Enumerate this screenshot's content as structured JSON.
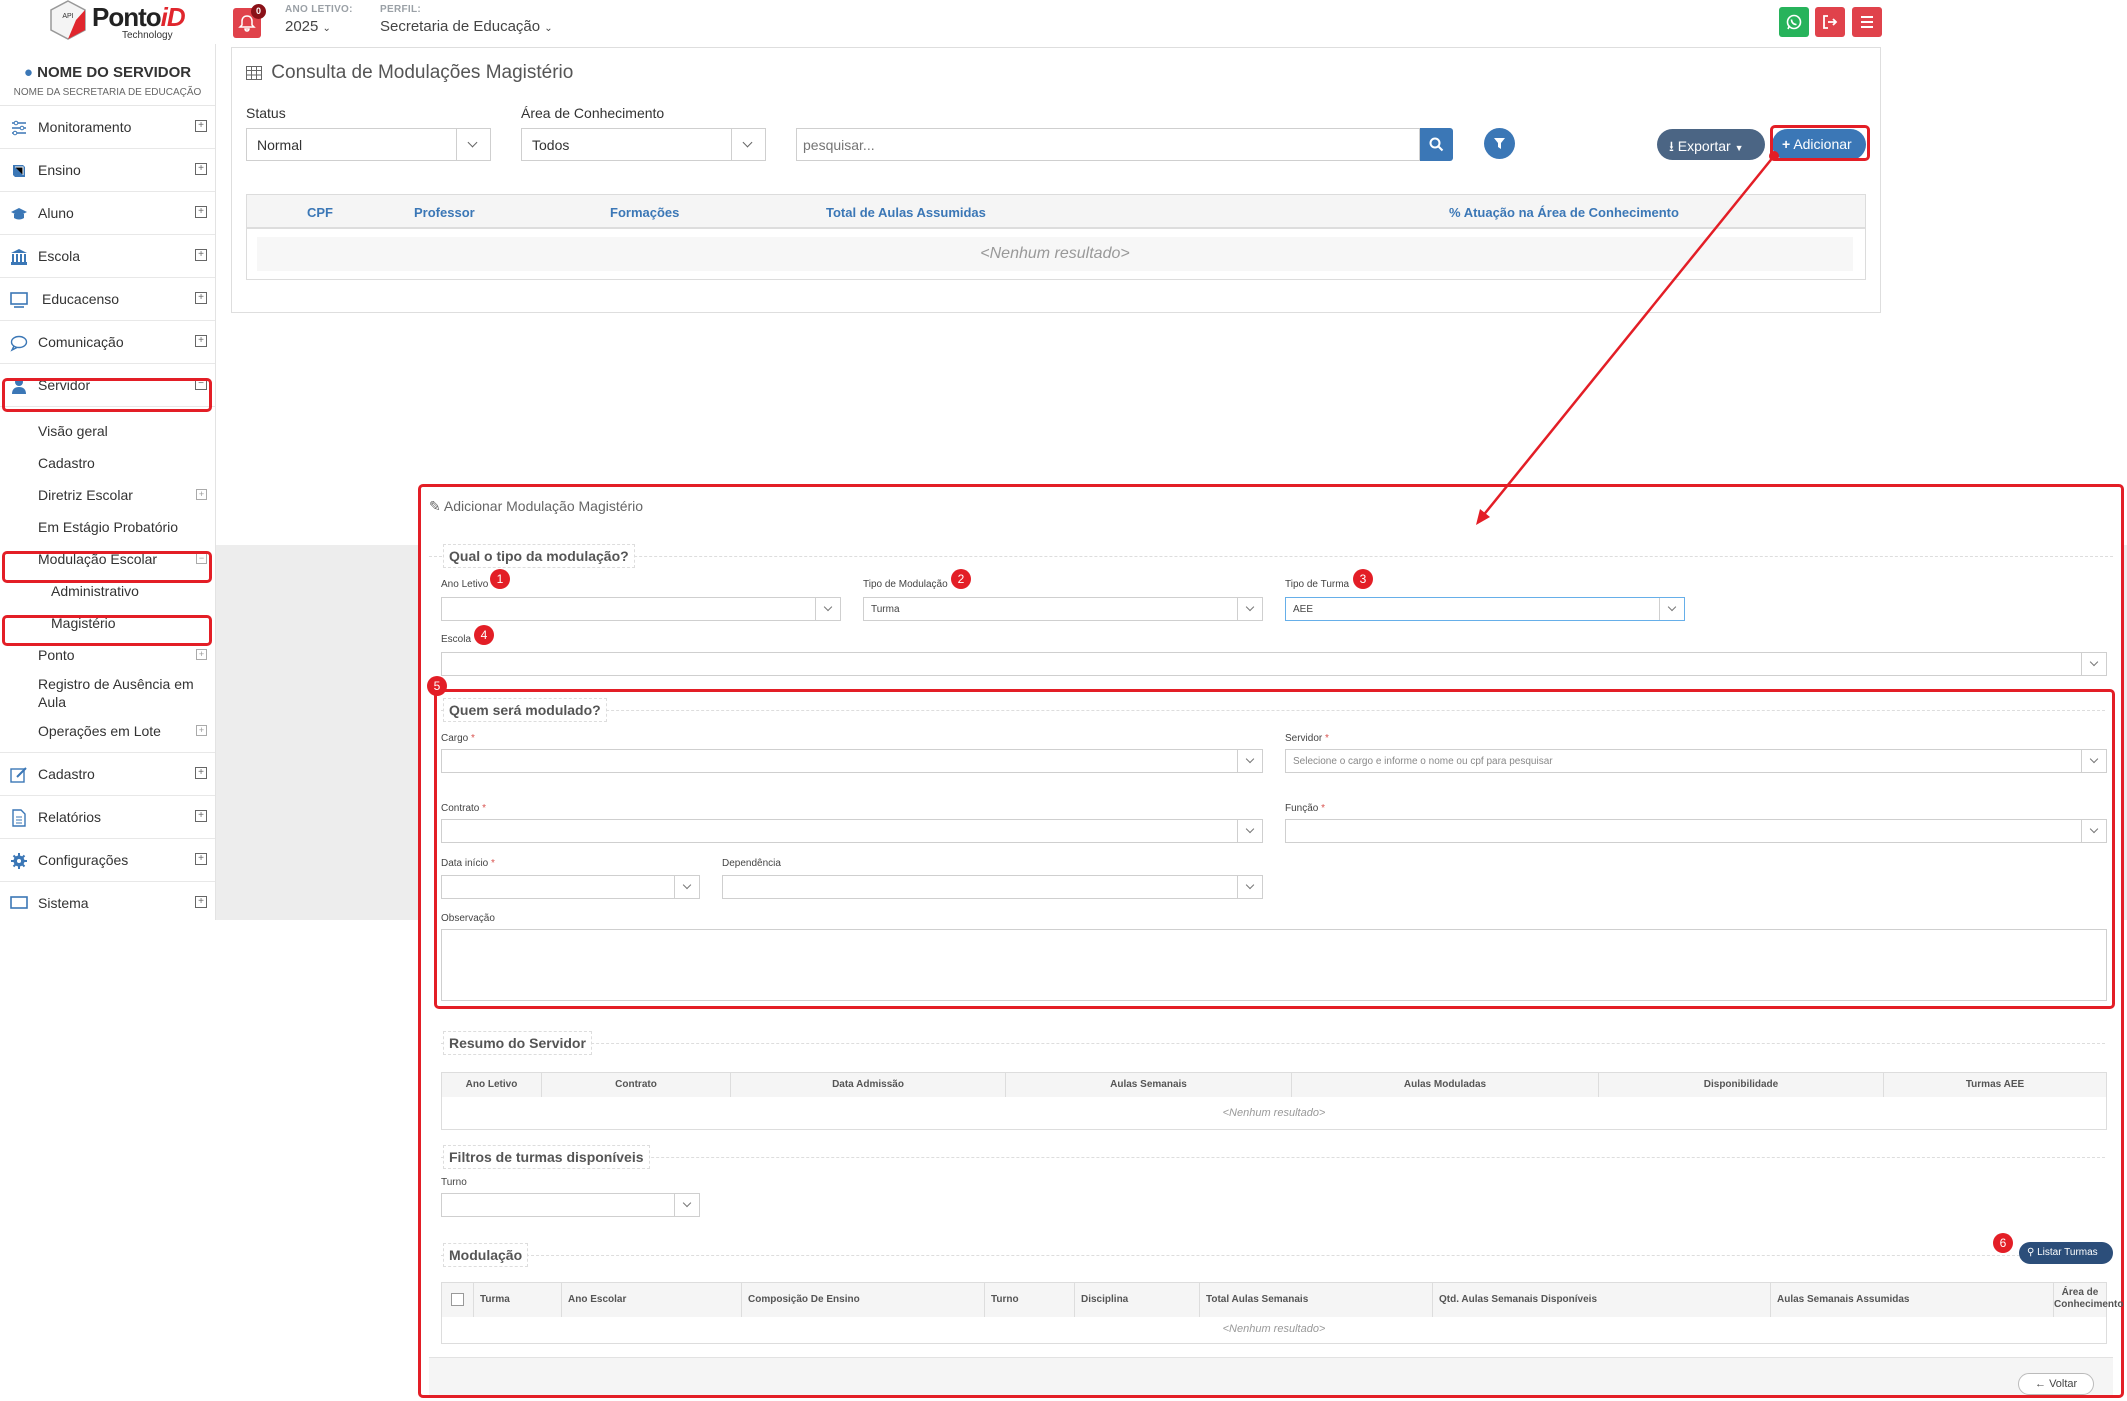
{
  "header": {
    "logo_brand_prefix": "Ponto",
    "logo_brand_suffix": "iD",
    "logo_tech": "Technology",
    "logo_badge": "API",
    "notification_count": "0",
    "year_label": "ANO LETIVO:",
    "year_value": "2025",
    "profile_label": "PERFIL:",
    "profile_value": "Secretaria de Educação",
    "colors": {
      "whatsapp": "#27b35b",
      "logout": "#e0424b",
      "menu": "#e0424b"
    },
    "buttons": [
      "whatsapp-icon",
      "logout-icon",
      "menu-icon"
    ]
  },
  "sidebar": {
    "user_name": "NOME DO SERVIDOR",
    "user_secretaria": "NOME DA SECRETARIA DE EDUCAÇÃO",
    "items": [
      {
        "label": "Monitoramento",
        "icon": "sliders-icon"
      },
      {
        "label": "Ensino",
        "icon": "book-icon"
      },
      {
        "label": "Aluno",
        "icon": "graduation-cap-icon"
      },
      {
        "label": "Escola",
        "icon": "bank-icon"
      },
      {
        "label": "Educacenso",
        "icon": "monitor-icon"
      },
      {
        "label": "Comunicação",
        "icon": "comment-icon"
      },
      {
        "label": "Servidor",
        "icon": "user-icon"
      }
    ],
    "servidor_sub": [
      {
        "label": "Visão geral"
      },
      {
        "label": "Cadastro"
      },
      {
        "label": "Diretriz Escolar"
      },
      {
        "label": "Em Estágio Probatório"
      },
      {
        "label": "Modulação Escolar"
      },
      {
        "label": "Administrativo"
      },
      {
        "label": "Magistério"
      },
      {
        "label": "Ponto"
      },
      {
        "label": "Registro de Ausência em Aula"
      },
      {
        "label": "Operações em Lote"
      }
    ],
    "bottom_items": [
      {
        "label": "Cadastro",
        "icon": "edit-icon"
      },
      {
        "label": "Relatórios",
        "icon": "file-icon"
      },
      {
        "label": "Configurações",
        "icon": "gear-icon"
      },
      {
        "label": "Sistema",
        "icon": "monitor-icon"
      }
    ]
  },
  "consulta": {
    "title": "Consulta de Modulações Magistério",
    "status_label": "Status",
    "status_value": "Normal",
    "area_label": "Área de Conhecimento",
    "area_value": "Todos",
    "search_placeholder": "pesquisar...",
    "export_label": "Exportar",
    "add_label": "Adicionar",
    "columns": [
      "CPF",
      "Professor",
      "Formações",
      "Total de Aulas Assumidas",
      "% Atuação na Área de Conhecimento"
    ],
    "empty": "<Nenhum resultado>"
  },
  "form": {
    "title": "Adicionar Modulação Magistério",
    "section_tipo": "Qual o tipo da modulação?",
    "ano_letivo_label": "Ano Letivo",
    "tipo_modulacao_label": "Tipo de Modulação",
    "tipo_modulacao_value": "Turma",
    "tipo_turma_label": "Tipo de Turma",
    "tipo_turma_value": "AEE",
    "escola_label": "Escola",
    "section_quem": "Quem será modulado?",
    "cargo_label": "Cargo",
    "servidor_label": "Servidor",
    "servidor_placeholder": "Selecione o cargo e informe o nome ou cpf para pesquisar",
    "contrato_label": "Contrato",
    "funcao_label": "Função",
    "data_inicio_label": "Data início",
    "dependencia_label": "Dependência",
    "observacao_label": "Observação",
    "required_mark": "*",
    "section_resumo": "Resumo do Servidor",
    "resumo_columns": [
      "Ano Letivo",
      "Contrato",
      "Data Admissão",
      "Aulas Semanais",
      "Aulas Moduladas",
      "Disponibilidade",
      "Turmas AEE"
    ],
    "resumo_empty": "<Nenhum resultado>",
    "section_filtros": "Filtros de turmas disponíveis",
    "turno_label": "Turno",
    "section_modulacao": "Modulação",
    "listar_label": "Listar Turmas",
    "modulacao_columns": [
      "Turma",
      "Ano Escolar",
      "Composição De Ensino",
      "Turno",
      "Disciplina",
      "Total Aulas Semanais",
      "Qtd. Aulas Semanais Disponíveis",
      "Aulas Semanais Assumidas",
      "Área de Conhecimento"
    ],
    "modulacao_empty": "<Nenhum resultado>",
    "voltar_label": "Voltar"
  },
  "markers": [
    "1",
    "2",
    "3",
    "4",
    "5",
    "6"
  ],
  "annotation_color": "#e31e26"
}
